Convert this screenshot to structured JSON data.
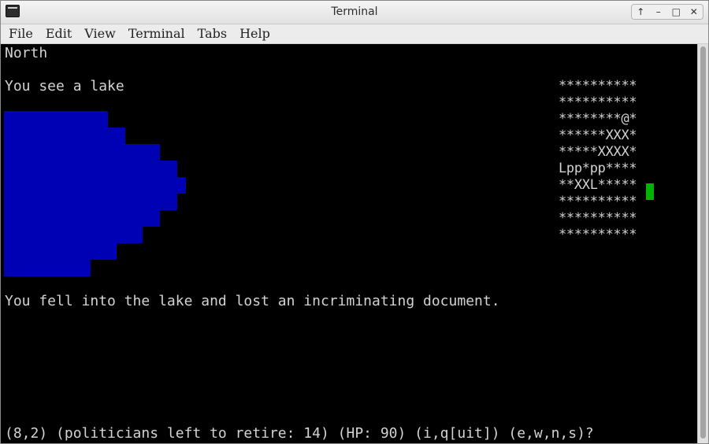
{
  "window": {
    "title": "Terminal"
  },
  "window_controls": [
    "↑",
    "–",
    "□",
    "✕"
  ],
  "menu": [
    "File",
    "Edit",
    "View",
    "Terminal",
    "Tabs",
    "Help"
  ],
  "terminal": {
    "direction": "North",
    "scene": "You see a lake",
    "message": "You fell into the lake and lost an incriminating document.",
    "status": "(8,2) (politicians left to retire: 14) (HP: 90) (i,q[uit]) (e,w,n,s)?",
    "map_rows": [
      "**********",
      "**********",
      "********@*",
      "******XXX*",
      "*****XXXX*",
      "Lpp*pp****",
      "**XXL*****",
      "**********",
      "**********",
      "**********"
    ],
    "lake_color": "#0000b4",
    "cursor_color": "#00b300"
  }
}
